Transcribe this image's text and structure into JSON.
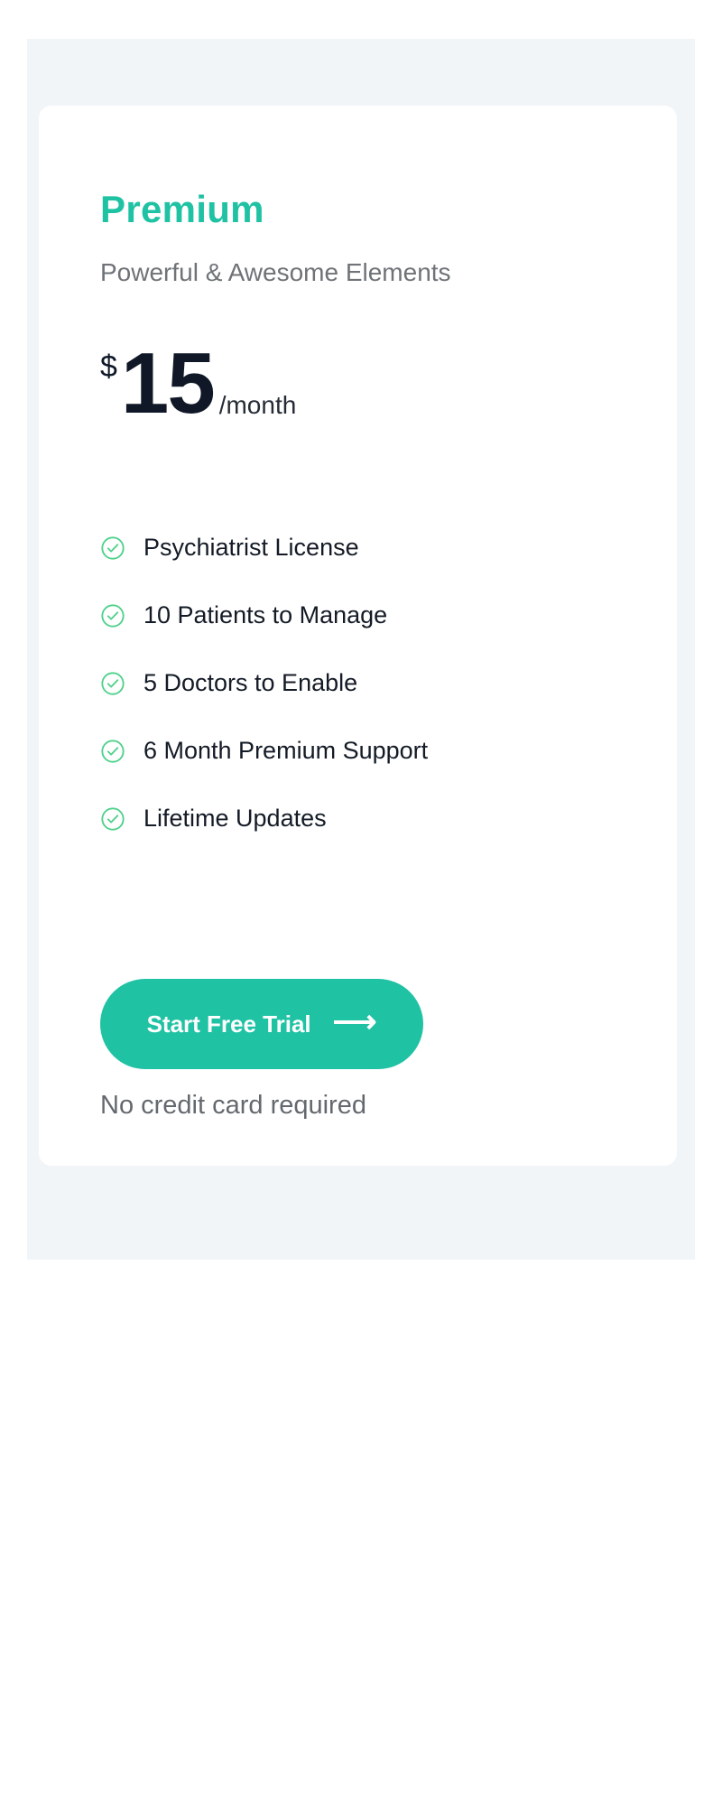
{
  "pricing_card": {
    "plan_name": "Premium",
    "subtitle": "Powerful & Awesome Elements",
    "price": {
      "currency": "$",
      "amount": "15",
      "period": "/month"
    },
    "features": [
      "Psychiatrist License",
      "10 Patients to Manage",
      "5 Doctors to Enable",
      "6 Month Premium Support",
      "Lifetime Updates"
    ],
    "feature_icon": "check-circle-icon",
    "cta": {
      "label": "Start Free Trial",
      "icon": "arrow-right-icon",
      "icon_glyph": "⟶"
    },
    "note": "No credit card required"
  },
  "colors": {
    "accent": "#20c2a4",
    "check": "#4fd18b",
    "section_background": "#f2f5f8",
    "card_background": "#ffffff",
    "text_primary": "#101828",
    "text_secondary": "#6f7377"
  }
}
